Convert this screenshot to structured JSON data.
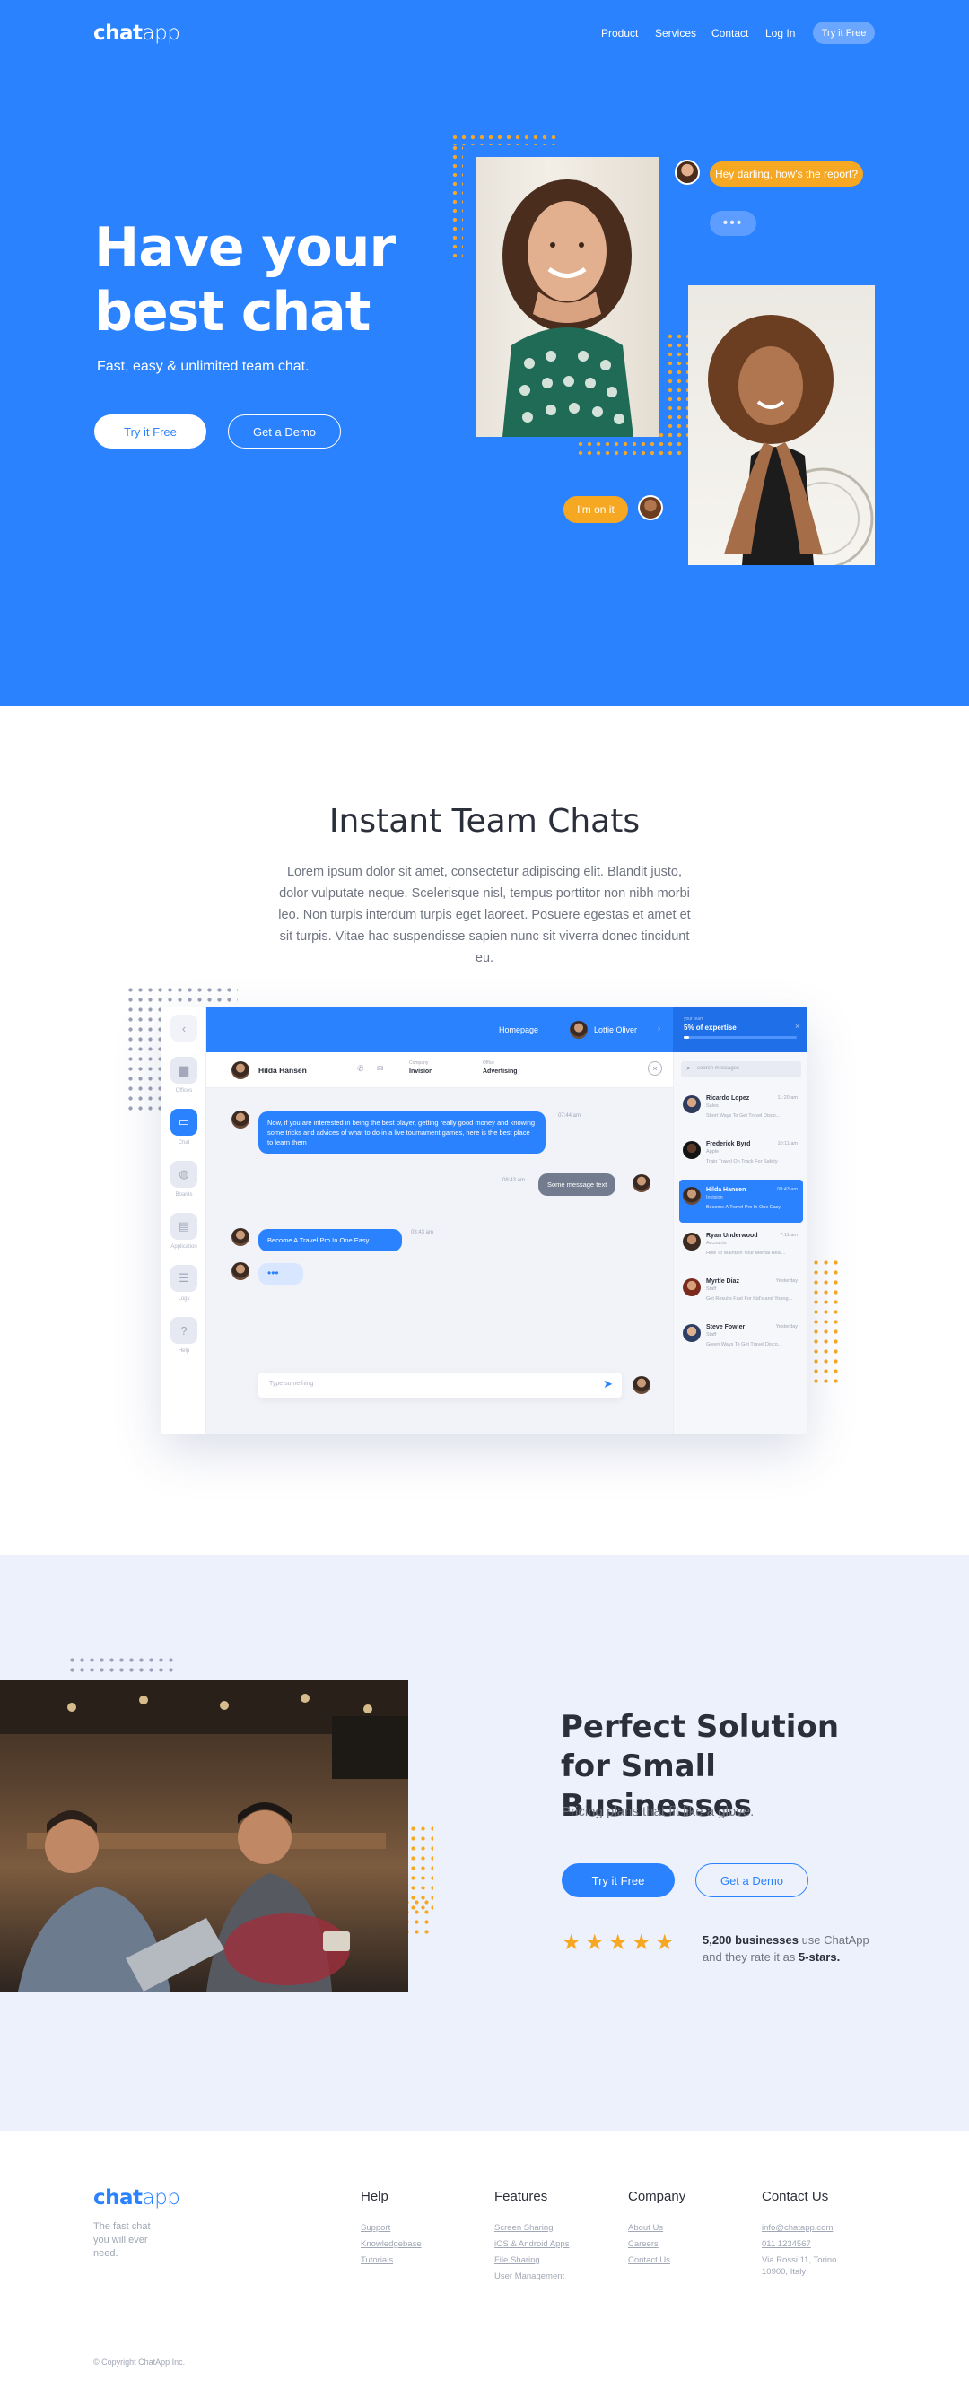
{
  "brand": {
    "logo_bold": "chat",
    "logo_light": "app"
  },
  "nav": {
    "product": "Product",
    "services": "Services",
    "contact": "Contact",
    "login": "Log In",
    "cta": "Try it Free"
  },
  "hero": {
    "title": "Have your best chat",
    "subtitle": "Fast, easy & unlimited team chat.",
    "primary_button": "Try it Free",
    "secondary_button": "Get a Demo",
    "bubble_top": "Hey darling, how's the report?",
    "bubble_bottom": "I'm on it"
  },
  "team_chats": {
    "title": "Instant Team Chats",
    "text": "Lorem ipsum dolor sit amet, consectetur adipiscing elit. Blandit justo, dolor vulputate neque. Scelerisque nisl, tempus porttitor non nibh morbi leo. Non turpis interdum turpis eget laoreet. Posuere egestas et amet et sit turpis. Vitae hac suspendisse sapien nunc sit viverra donec tincidunt eu."
  },
  "app": {
    "sidebar": [
      {
        "label": "Offices",
        "icon": "briefcase-icon"
      },
      {
        "label": "Chat",
        "icon": "chat-icon"
      },
      {
        "label": "Boards",
        "icon": "globe-icon"
      },
      {
        "label": "Application",
        "icon": "document-icon"
      },
      {
        "label": "Logs",
        "icon": "list-icon"
      },
      {
        "label": "Help",
        "icon": "help-icon"
      }
    ],
    "topbar": {
      "homepage": "Homepage",
      "user": "Lottie Oliver",
      "progress_label": "your team",
      "progress_value": "5% of expertise"
    },
    "conversation": {
      "name": "Hilda Hansen",
      "field1_label": "Company",
      "field1_value": "Invision",
      "field2_label": "Office",
      "field2_value": "Advertising"
    },
    "messages": [
      {
        "text": "Now, if you are interested in being the best player, getting really good money and knowing some tricks and advices of what to do in a live tournament games, here is the best place to learn them",
        "time": "07:44 am"
      },
      {
        "text": "Some message text",
        "time": "08:43 am"
      },
      {
        "text": "Become A Travel Pro In One Easy",
        "time": "08:43 am"
      }
    ],
    "input_placeholder": "Type something",
    "search_placeholder": "search messages",
    "contacts": [
      {
        "name": "Ricardo Lopez",
        "role": "Sales",
        "preview": "Short Ways To Get Travel Disco...",
        "time": "11:20 am"
      },
      {
        "name": "Frederick Byrd",
        "role": "Apple",
        "preview": "Train Travel On Track For Safety",
        "time": "10:11 am"
      },
      {
        "name": "Hilda Hansen",
        "role": "Invision",
        "preview": "Become A Travel Pro In One Easy",
        "time": "08:43 am"
      },
      {
        "name": "Ryan Underwood",
        "role": "Accounts",
        "preview": "How To Maintain Your Mental Heal...",
        "time": "7:11 am"
      },
      {
        "name": "Myrtle Diaz",
        "role": "Staff",
        "preview": "Get Results Fast For Kid's and Young...",
        "time": "Yesterday"
      },
      {
        "name": "Steve Fowler",
        "role": "Staff",
        "preview": "Green Ways To Get Travel Disco...",
        "time": "Yesterday"
      }
    ]
  },
  "solution": {
    "title": "Perfect Solution for Small Businesses",
    "subtitle": "Pricing plans that fit like a glove.",
    "primary_button": "Try it Free",
    "secondary_button": "Get a Demo",
    "rating": 5,
    "rating_strong": "5,200 businesses",
    "rating_text1": " use ChatApp",
    "rating_text2": "and they rate it as ",
    "rating_strong2": "5-stars."
  },
  "footer": {
    "tagline": "The fast chat you will ever need.",
    "columns": [
      {
        "title": "Help",
        "links": [
          "Support",
          "Knowledgebase",
          "Tutorials"
        ]
      },
      {
        "title": "Features",
        "links": [
          "Screen Sharing",
          "iOS & Android Apps",
          "File Sharing",
          "User Management"
        ]
      },
      {
        "title": "Company",
        "links": [
          "About Us",
          "Careers",
          "Contact Us"
        ]
      },
      {
        "title": "Contact Us",
        "links": [
          "info@chatapp.com",
          "011 1234567",
          "Via Rossi 11, Torino 10900, Italy"
        ]
      }
    ],
    "copyright": "© Copyright ChatApp Inc."
  },
  "colors": {
    "brand_blue": "#2b82ff",
    "accent_orange": "#f7a823",
    "light_bg": "#edf1fc",
    "dark_text": "#2b2f3a"
  }
}
